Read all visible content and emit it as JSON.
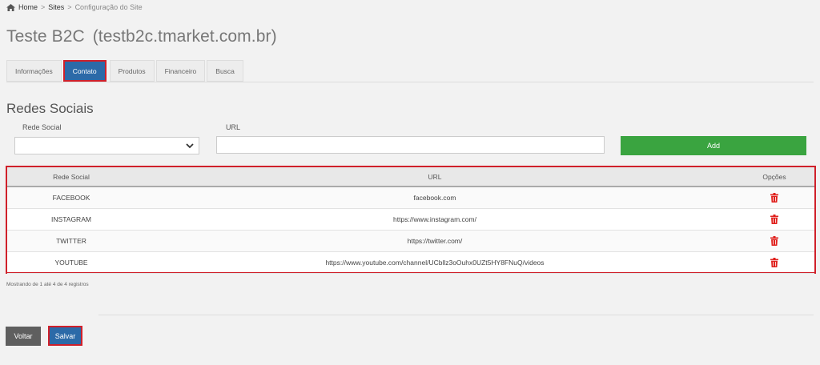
{
  "breadcrumb": {
    "home": "Home",
    "sites": "Sites",
    "current": "Configuração do Site",
    "separator": ">"
  },
  "page": {
    "title": "Teste B2C",
    "subtitle": "(testb2c.tmarket.com.br)"
  },
  "tabs": [
    {
      "label": "Informações",
      "active": false
    },
    {
      "label": "Contato",
      "active": true
    },
    {
      "label": "Produtos",
      "active": false
    },
    {
      "label": "Financeiro",
      "active": false
    },
    {
      "label": "Busca",
      "active": false
    }
  ],
  "section": {
    "title": "Redes Sociais",
    "rede_label": "Rede Social",
    "url_label": "URL",
    "url_value": "",
    "add_label": "Add"
  },
  "table": {
    "headers": {
      "rede": "Rede Social",
      "url": "URL",
      "opcoes": "Opções"
    },
    "rows": [
      {
        "rede": "FACEBOOK",
        "url": "facebook.com"
      },
      {
        "rede": "INSTAGRAM",
        "url": "https://www.instagram.com/"
      },
      {
        "rede": "TWITTER",
        "url": "https://twitter.com/"
      },
      {
        "rede": "YOUTUBE",
        "url": "https://www.youtube.com/channel/UCbllz3oOuhx0UZt5HY8FNuQ/videos"
      }
    ]
  },
  "records_text": "Mostrando de 1 até 4 de 4 registros",
  "buttons": {
    "voltar": "Voltar",
    "salvar": "Salvar"
  },
  "colors": {
    "primary": "#2c6aa8",
    "success": "#3aa440",
    "danger": "#d0202a",
    "secondary": "#5f5f5f"
  },
  "icons": {
    "home": "home-icon",
    "chevron": "chevron-down-icon",
    "delete": "trash-icon"
  }
}
